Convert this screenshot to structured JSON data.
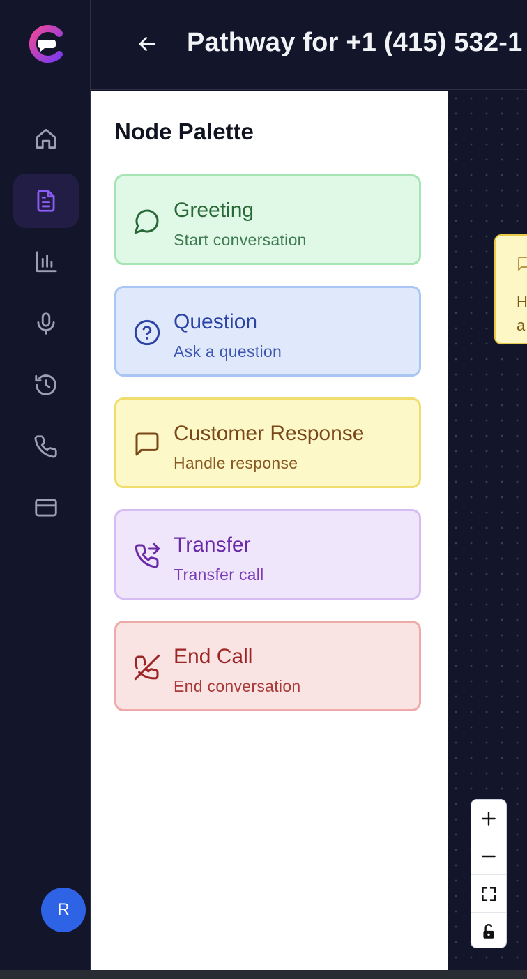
{
  "header": {
    "title": "Pathway for +1 (415) 532-1"
  },
  "sidebar": {
    "items": [
      {
        "icon": "home-icon",
        "active": false
      },
      {
        "icon": "document-icon",
        "active": true
      },
      {
        "icon": "bar-chart-icon",
        "active": false
      },
      {
        "icon": "microphone-icon",
        "active": false
      },
      {
        "icon": "history-icon",
        "active": false
      },
      {
        "icon": "phone-icon",
        "active": false
      },
      {
        "icon": "credit-card-icon",
        "active": false
      }
    ],
    "avatar_initial": "R"
  },
  "palette": {
    "title": "Node Palette",
    "nodes": [
      {
        "name": "Greeting",
        "description": "Start conversation",
        "icon": "message-circle-icon",
        "bg": "#e0f8e6",
        "border": "#a6e4b4",
        "color": "#2a6a39"
      },
      {
        "name": "Question",
        "description": "Ask a question",
        "icon": "help-circle-icon",
        "bg": "#dfe9fb",
        "border": "#a9c6f4",
        "color": "#2b43a5"
      },
      {
        "name": "Customer Response",
        "description": "Handle response",
        "icon": "message-square-icon",
        "bg": "#fdf8c8",
        "border": "#f1dc6e",
        "color": "#7a4718"
      },
      {
        "name": "Transfer",
        "description": "Transfer call",
        "icon": "phone-forwarded-icon",
        "bg": "#efe6fc",
        "border": "#d5bdf3",
        "color": "#6a2aa6"
      },
      {
        "name": "End Call",
        "description": "End conversation",
        "icon": "phone-off-icon",
        "bg": "#fae3e3",
        "border": "#eea9a9",
        "color": "#9c2525"
      }
    ]
  },
  "canvas": {
    "node_text": [
      "H",
      "a"
    ]
  },
  "colors": {
    "background": "#13162a",
    "accent": "#7c4ddb",
    "brand_gradient": [
      "#ec4899",
      "#7c3aed"
    ]
  }
}
